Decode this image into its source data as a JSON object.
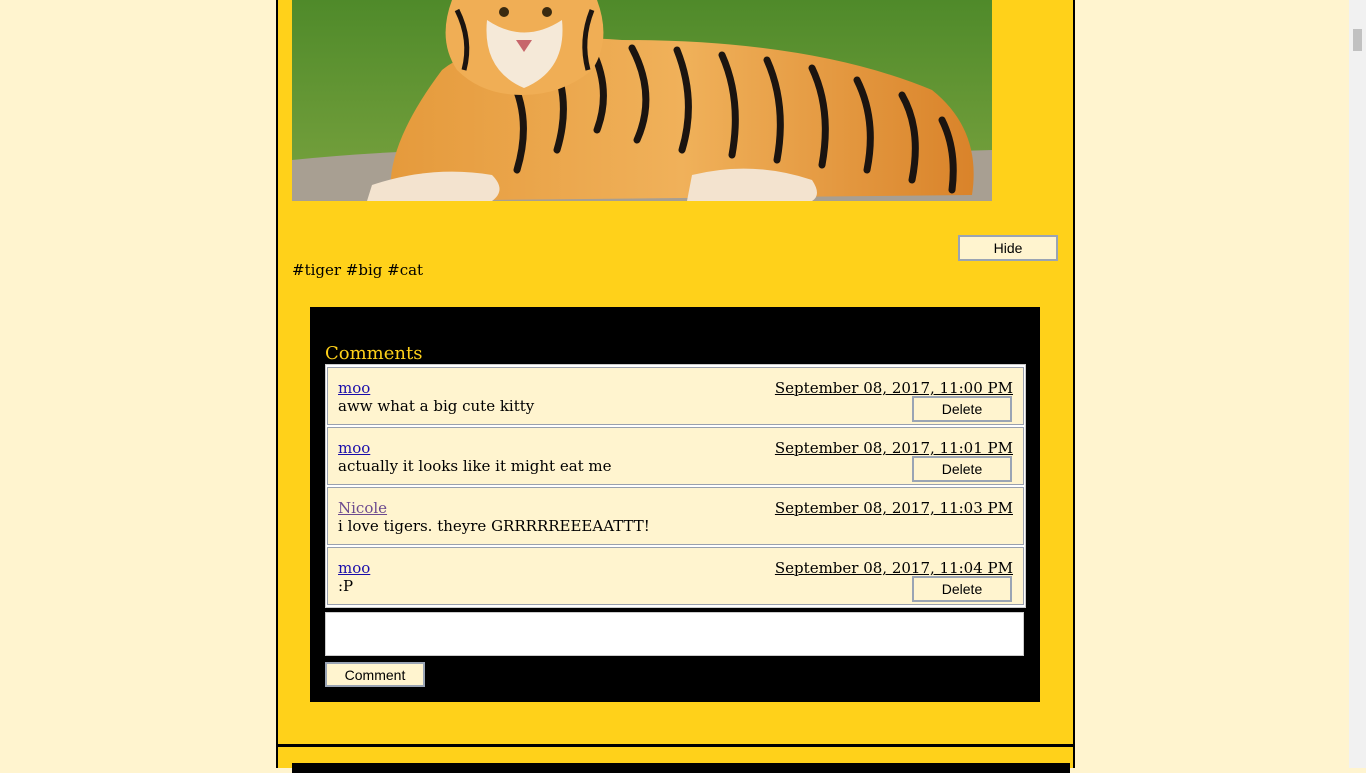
{
  "post": {
    "hide_label": "Hide",
    "tags": "#tiger #big #cat",
    "image_icon": "tiger-photo"
  },
  "comments": {
    "title": "Comments",
    "items": [
      {
        "user": "moo",
        "date": "September 08, 2017, 11:00 PM",
        "text": "aww what a big cute kitty",
        "delete_label": "Delete"
      },
      {
        "user": "moo",
        "date": "September 08, 2017, 11:01 PM",
        "text": "actually it looks like it might eat me",
        "delete_label": "Delete"
      },
      {
        "user": "Nicole",
        "date": "September 08, 2017, 11:03 PM",
        "text": "i love tigers. theyre GRRRRREEEAATTT!"
      },
      {
        "user": "moo",
        "date": "September 08, 2017, 11:04 PM",
        "text": ":P",
        "delete_label": "Delete"
      }
    ],
    "input_value": "",
    "comment_label": "Comment"
  },
  "colors": {
    "page_bg": "#fff4cf",
    "post_bg": "#ffd11a",
    "panel_bg": "#000000",
    "title": "#ffd11a",
    "link": "#1a0dab",
    "visited_link": "#6c4a8f"
  }
}
